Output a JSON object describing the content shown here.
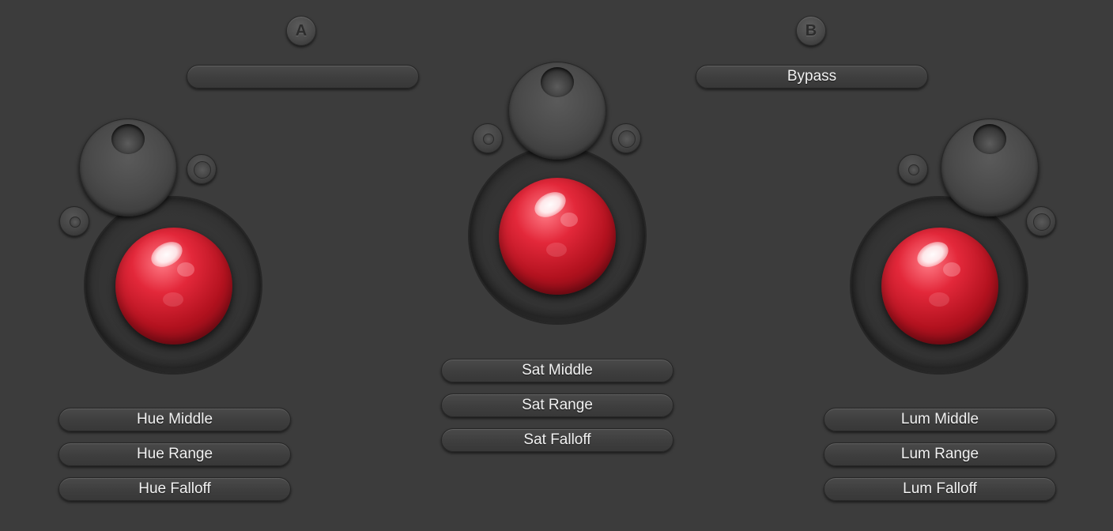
{
  "slots": {
    "a_label": "A",
    "b_label": "B"
  },
  "top": {
    "left_pill_label": "",
    "bypass_label": "Bypass"
  },
  "hue": {
    "middle": "Hue Middle",
    "range": "Hue Range",
    "falloff": "Hue Falloff"
  },
  "sat": {
    "middle": "Sat Middle",
    "range": "Sat Range",
    "falloff": "Sat Falloff"
  },
  "lum": {
    "middle": "Lum Middle",
    "range": "Lum Range",
    "falloff": "Lum Falloff"
  },
  "colors": {
    "background": "#3c3c3c",
    "ball_red": "#e3283a"
  }
}
